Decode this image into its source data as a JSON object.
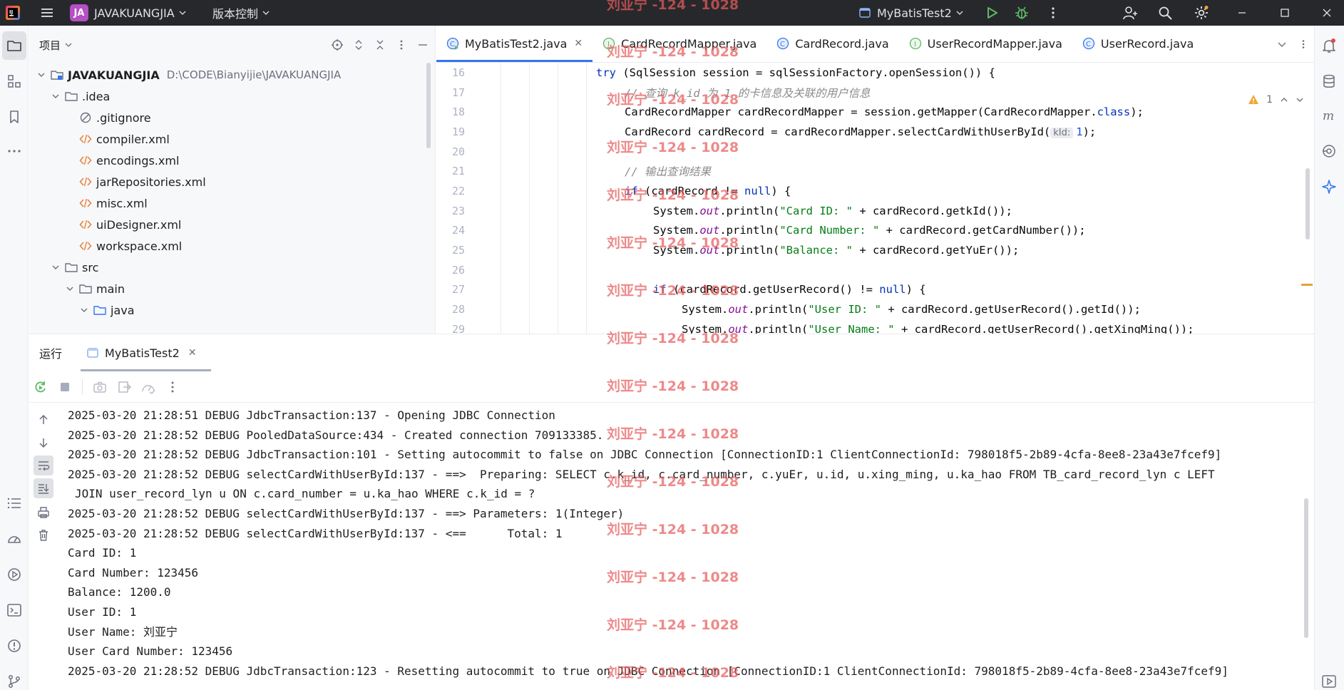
{
  "titlebar": {
    "project_badge": "JA",
    "project_name": "JAVAKUANGJIA",
    "vcs_label": "版本控制",
    "run_config": "MyBatisTest2"
  },
  "project_pane": {
    "title": "项目",
    "tree": [
      {
        "label": "JAVAKUANGJIA",
        "path": "D:\\CODE\\Bianyijie\\JAVAKUANGJIA",
        "depth": 0,
        "type": "module",
        "expanded": true
      },
      {
        "label": ".idea",
        "depth": 1,
        "type": "folder",
        "expanded": true
      },
      {
        "label": ".gitignore",
        "depth": 2,
        "type": "ignore"
      },
      {
        "label": "compiler.xml",
        "depth": 2,
        "type": "xml"
      },
      {
        "label": "encodings.xml",
        "depth": 2,
        "type": "xml"
      },
      {
        "label": "jarRepositories.xml",
        "depth": 2,
        "type": "xml"
      },
      {
        "label": "misc.xml",
        "depth": 2,
        "type": "xml"
      },
      {
        "label": "uiDesigner.xml",
        "depth": 2,
        "type": "xml"
      },
      {
        "label": "workspace.xml",
        "depth": 2,
        "type": "xml"
      },
      {
        "label": "src",
        "depth": 1,
        "type": "folder",
        "expanded": true
      },
      {
        "label": "main",
        "depth": 2,
        "type": "folder",
        "expanded": true
      },
      {
        "label": "java",
        "depth": 3,
        "type": "srcfolder",
        "expanded": true
      }
    ]
  },
  "editor": {
    "tabs": [
      {
        "label": "MyBatisTest2.java",
        "icon": "java-run-class-icon",
        "active": true
      },
      {
        "label": "CardRecordMapper.java",
        "icon": "interface-icon",
        "active": false
      },
      {
        "label": "CardRecord.java",
        "icon": "class-icon",
        "active": false
      },
      {
        "label": "UserRecordMapper.java",
        "icon": "interface-icon",
        "active": false
      },
      {
        "label": "UserRecord.java",
        "icon": "class-icon",
        "active": false
      }
    ],
    "warning_count": "1",
    "line_numbers": [
      "16",
      "17",
      "18",
      "19",
      "20",
      "21",
      "22",
      "23",
      "24",
      "25",
      "26",
      "27",
      "28",
      "29"
    ],
    "code": {
      "l16": {
        "kw": "try",
        "rest": " (SqlSession session = sqlSessionFactory.openSession()) {"
      },
      "l17": {
        "comment": "// 查询 k_id 为 1 的卡信息及关联的用户信息"
      },
      "l18": {
        "a": "CardRecordMapper cardRecordMapper = session.getMapper(CardRecordMapper.",
        "kw": "class",
        "b": ");"
      },
      "l19": {
        "a": "CardRecord cardRecord = cardRecordMapper.selectCardWithUserById(",
        "hint": "kId:",
        "num": "1",
        "b": ");"
      },
      "l21": {
        "comment": "// 输出查询结果"
      },
      "l22": {
        "kw": "if",
        "a": " (cardRecord != ",
        "kw2": "null",
        "b": ") {"
      },
      "l23": {
        "a": "System.",
        "field": "out",
        "b": ".println(",
        "str": "\"Card ID: \"",
        "c": " + cardRecord.getkId());"
      },
      "l24": {
        "a": "System.",
        "field": "out",
        "b": ".println(",
        "str": "\"Card Number: \"",
        "c": " + cardRecord.getCardNumber());"
      },
      "l25": {
        "a": "System.",
        "field": "out",
        "b": ".println(",
        "str": "\"Balance: \"",
        "c": " + cardRecord.getYuEr());"
      },
      "l27": {
        "kw": "if",
        "a": " (cardRecord.getUserRecord() != ",
        "kw2": "null",
        "b": ") {"
      },
      "l28": {
        "a": "System.",
        "field": "out",
        "b": ".println(",
        "str": "\"User ID: \"",
        "c": " + cardRecord.getUserRecord().getId());"
      },
      "l29": {
        "a": "System.",
        "field": "out",
        "b": ".println(",
        "str": "\"User Name: \"",
        "c": " + cardRecord.getUserRecord().getXingMing());"
      }
    }
  },
  "run_panel": {
    "label": "运行",
    "tab": "MyBatisTest2",
    "console": [
      "2025-03-20 21:28:51 DEBUG JdbcTransaction:137 - Opening JDBC Connection",
      "2025-03-20 21:28:52 DEBUG PooledDataSource:434 - Created connection 709133385.",
      "2025-03-20 21:28:52 DEBUG JdbcTransaction:101 - Setting autocommit to false on JDBC Connection [ConnectionID:1 ClientConnectionId: 798018f5-2b89-4cfa-8ee8-23a43e7fcef9]",
      "2025-03-20 21:28:52 DEBUG selectCardWithUserById:137 - ==>  Preparing: SELECT c.k_id, c.card_number, c.yuEr, u.id, u.xing_ming, u.ka_hao FROM TB_card_record_lyn c LEFT",
      "JOIN user_record_lyn u ON c.card_number = u.ka_hao WHERE c.k_id = ?",
      "2025-03-20 21:28:52 DEBUG selectCardWithUserById:137 - ==> Parameters: 1(Integer)",
      "2025-03-20 21:28:52 DEBUG selectCardWithUserById:137 - <==      Total: 1",
      "Card ID: 1",
      "Card Number: 123456",
      "Balance: 1200.0",
      "User ID: 1",
      "User Name: 刘亚宁",
      "User Card Number: 123456",
      "2025-03-20 21:28:52 DEBUG JdbcTransaction:123 - Resetting autocommit to true on JDBC Connection [ConnectionID:1 ClientConnectionId: 798018f5-2b89-4cfa-8ee8-23a43e7fcef9]"
    ]
  },
  "watermark": {
    "text": "刘亚宁 -124 - 1028"
  },
  "colors": {
    "accent": "#3574f0",
    "titlebar_bg": "#27282c",
    "project_badge": "#b44fc4",
    "run_green": "#5fb865",
    "watermark": "#e75c5c"
  }
}
